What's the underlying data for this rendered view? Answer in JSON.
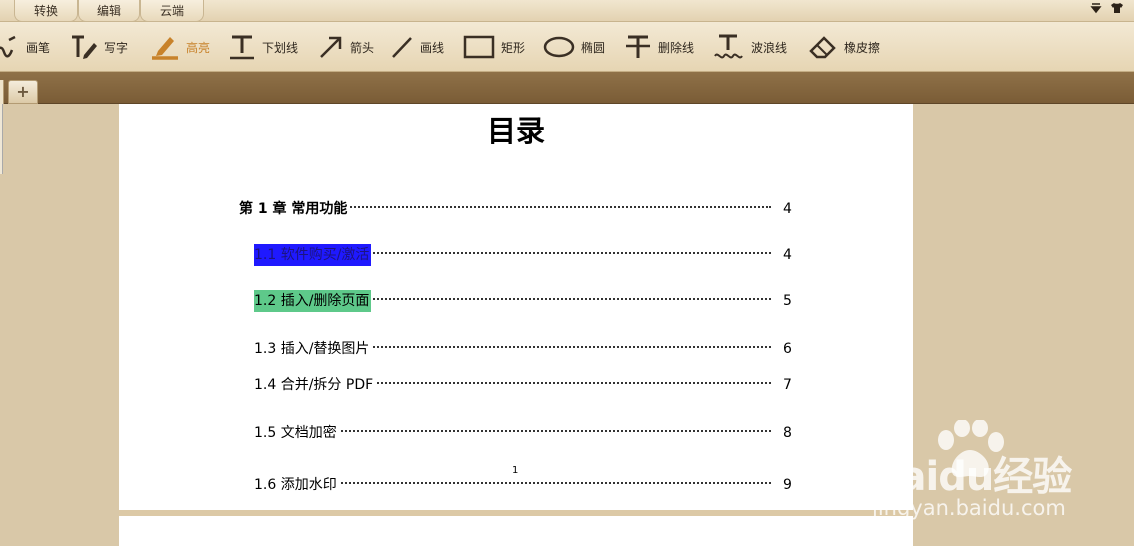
{
  "tabs": [
    {
      "label": "转换"
    },
    {
      "label": "编辑"
    },
    {
      "label": "云端"
    }
  ],
  "window_icons": [
    "dropdown-arrow-icon",
    "shirt-icon"
  ],
  "toolbar": {
    "pen": "画笔",
    "write": "写字",
    "highlight": "高亮",
    "underline": "下划线",
    "arrow": "箭头",
    "line": "画线",
    "rect": "矩形",
    "ellipse": "椭圆",
    "strike": "删除线",
    "wave": "波浪线",
    "eraser": "橡皮擦",
    "active_tool": "highlight",
    "active_color": "#c8822a"
  },
  "doc_tabs": {
    "add_label": "+"
  },
  "document": {
    "title": "目录",
    "toc": [
      {
        "label": "第 1 章  常用功能",
        "page": "4",
        "bold": true,
        "highlight": "none"
      },
      {
        "label": "1.1 软件购买/激活",
        "page": "4",
        "bold": false,
        "highlight": "blue"
      },
      {
        "label": "1.2 插入/删除页面",
        "page": "5",
        "bold": false,
        "highlight": "green"
      },
      {
        "label": "1.3 插入/替换图片",
        "page": "6",
        "bold": false,
        "highlight": "none"
      },
      {
        "label": "1.4 合并/拆分 PDF",
        "page": "7",
        "bold": false,
        "highlight": "none"
      },
      {
        "label": "1.5 文档加密",
        "page": "8",
        "bold": false,
        "highlight": "none"
      },
      {
        "label": "1.6 添加水印",
        "page": "9",
        "bold": false,
        "highlight": "none"
      }
    ],
    "page_number": "1"
  },
  "highlight_colors": {
    "blue": "#1f19ff",
    "green": "#5ec98a"
  },
  "watermark": {
    "main": "Baidu经验",
    "sub": "jingyan.baidu.com"
  }
}
